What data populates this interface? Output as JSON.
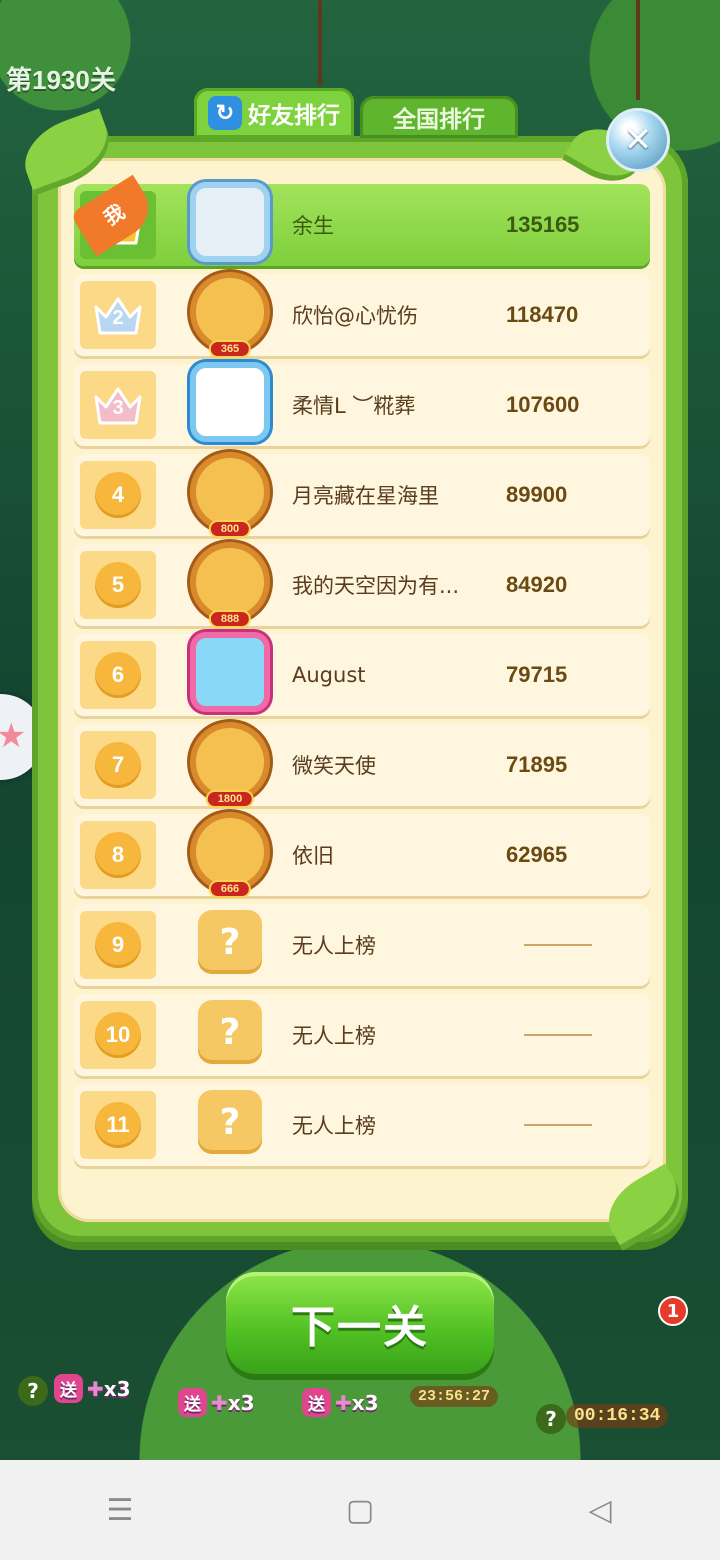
{
  "level": {
    "label": "第1930关"
  },
  "tabs": [
    {
      "label": "好友排行",
      "active": true
    },
    {
      "label": "全国排行",
      "active": false
    }
  ],
  "me_label": "我",
  "rows": [
    {
      "rank": "1",
      "name": "余生",
      "score": "135165",
      "is_me": true,
      "badge": ""
    },
    {
      "rank": "2",
      "name": "欣怡@心忧伤",
      "score": "118470",
      "is_me": false,
      "badge": "365"
    },
    {
      "rank": "3",
      "name": "柔情L ︶糀葬",
      "score": "107600",
      "is_me": false,
      "badge": ""
    },
    {
      "rank": "4",
      "name": "月亮藏在星海里",
      "score": "89900",
      "is_me": false,
      "badge": "800"
    },
    {
      "rank": "5",
      "name": "我的天空因为有...",
      "score": "84920",
      "is_me": false,
      "badge": "888"
    },
    {
      "rank": "6",
      "name": "August",
      "score": "79715",
      "is_me": false,
      "badge": ""
    },
    {
      "rank": "7",
      "name": "微笑天使",
      "score": "71895",
      "is_me": false,
      "badge": "1800"
    },
    {
      "rank": "8",
      "name": "依旧",
      "score": "62965",
      "is_me": false,
      "badge": "666"
    },
    {
      "rank": "9",
      "name": "无人上榜",
      "score": "",
      "is_me": false,
      "badge": ""
    },
    {
      "rank": "10",
      "name": "无人上榜",
      "score": "",
      "is_me": false,
      "badge": ""
    },
    {
      "rank": "11",
      "name": "无人上榜",
      "score": "",
      "is_me": false,
      "badge": ""
    }
  ],
  "placeholder_avatar_symbol": "?",
  "next_button": {
    "label": "下一关"
  },
  "bottom": {
    "gifts": [
      {
        "send_label": "送",
        "count": "x3"
      },
      {
        "send_label": "送",
        "count": "x3"
      },
      {
        "send_label": "送",
        "count": "x3"
      }
    ],
    "timer_1": "23:56:27",
    "timer_2": "00:16:34",
    "notification_count": "1"
  },
  "colors": {
    "panel_green": "#7ec53c",
    "row_cream": "#fff6df",
    "rank_orange": "#f6b73c",
    "me_row_green": "#8fd84a"
  }
}
